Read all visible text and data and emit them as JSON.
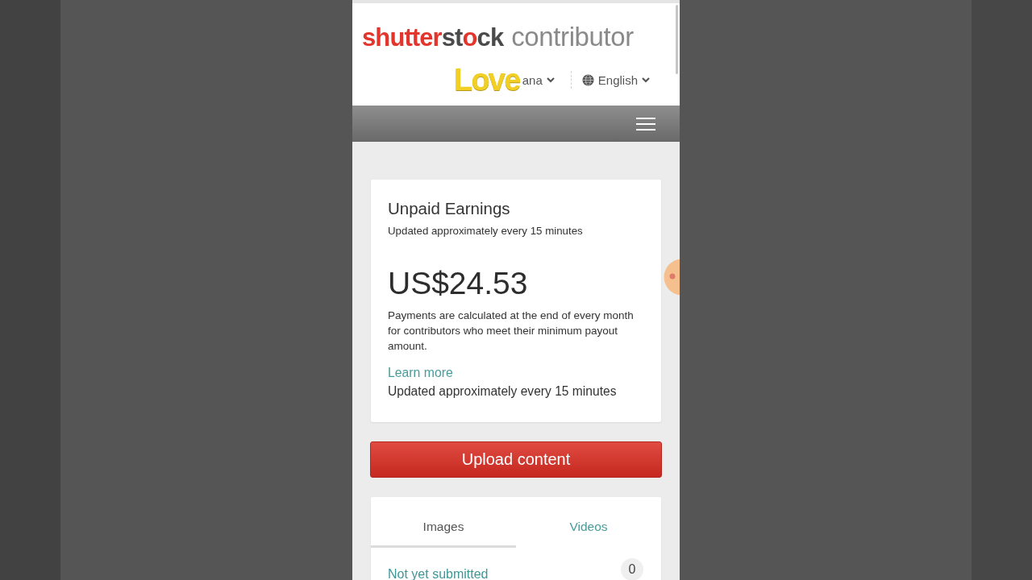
{
  "header": {
    "logo": {
      "parts": [
        {
          "text": "shutter",
          "kind": "accent"
        },
        {
          "text": "st",
          "kind": "base"
        },
        {
          "text": "o",
          "kind": "accent"
        },
        {
          "text": "ck",
          "kind": "base"
        }
      ],
      "product": "contributor"
    },
    "user_menu": {
      "label": "ana"
    },
    "language_menu": {
      "label": "English"
    }
  },
  "sticker": {
    "text": "Love"
  },
  "earnings_card": {
    "title": "Unpaid Earnings",
    "subtitle": "Updated approximately every 15 minutes",
    "amount": "US$24.53",
    "note": "Payments are calculated at the end of every month for contributors who meet their minimum payout amount.",
    "link": "Learn more",
    "footer": "Updated approximately every 15 minutes"
  },
  "upload_button": {
    "label": "Upload content"
  },
  "media_tabs": {
    "tabs": [
      {
        "label": "Images",
        "selected": true
      },
      {
        "label": "Videos",
        "selected": false
      }
    ],
    "rows": [
      {
        "label": "Not yet submitted",
        "count": "0"
      }
    ]
  }
}
